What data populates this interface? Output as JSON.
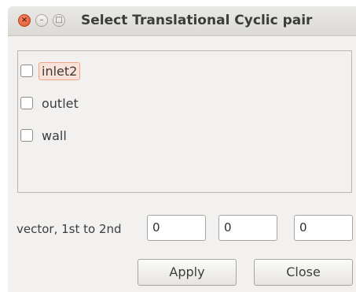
{
  "window": {
    "title": "Select Translational Cyclic pair",
    "controls": {
      "close_glyph": "×",
      "minimize_glyph": "–",
      "maximize_glyph": "□"
    }
  },
  "patches": [
    {
      "label": "inlet2",
      "checked": false,
      "focused": true
    },
    {
      "label": "outlet",
      "checked": false,
      "focused": false
    },
    {
      "label": "wall",
      "checked": false,
      "focused": false
    }
  ],
  "vector": {
    "label": "vector, 1st to 2nd",
    "x": "0",
    "y": "0",
    "z": "0"
  },
  "buttons": {
    "apply": "Apply",
    "close": "Close"
  },
  "colors": {
    "focus_background": "#fbe2d8",
    "focus_border": "#f0a487",
    "window_background": "#f2f1f0",
    "close_button": "#e0542b"
  },
  "icons": [
    "close-icon",
    "minimize-icon",
    "maximize-icon"
  ]
}
